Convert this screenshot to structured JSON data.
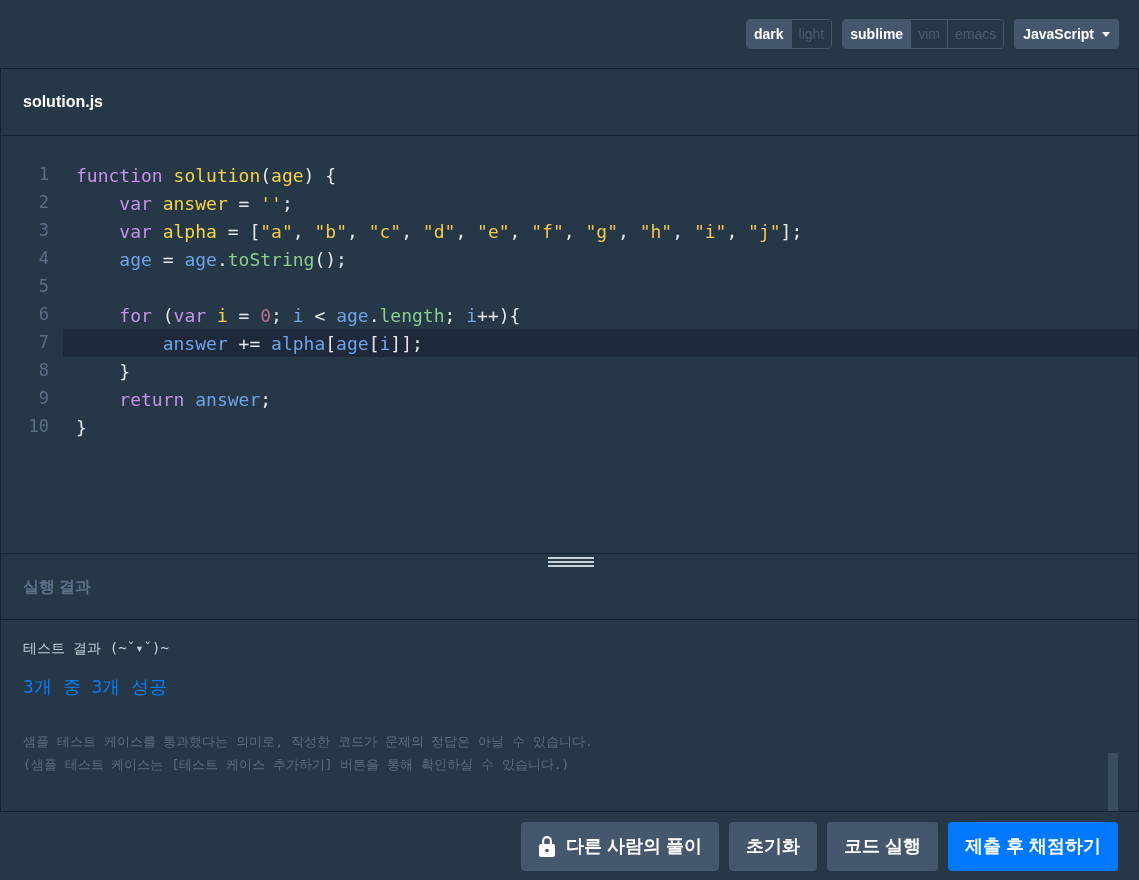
{
  "toolbar": {
    "groups": [
      {
        "options": [
          {
            "label": "dark",
            "selected": true
          },
          {
            "label": "light",
            "selected": false
          }
        ]
      },
      {
        "options": [
          {
            "label": "sublime",
            "selected": true
          },
          {
            "label": "vim",
            "selected": false
          },
          {
            "label": "emacs",
            "selected": false
          }
        ]
      }
    ],
    "language": "JavaScript"
  },
  "editor": {
    "filename": "solution.js",
    "lines": [
      {
        "number": "1",
        "active": false,
        "tokens": [
          {
            "kind": "kw",
            "text": "function"
          },
          {
            "kind": "def",
            "text": " solution"
          },
          {
            "kind": "p",
            "text": "("
          },
          {
            "kind": "def",
            "text": "age"
          },
          {
            "kind": "p",
            "text": ") {"
          }
        ]
      },
      {
        "number": "2",
        "active": false,
        "tokens": [
          {
            "kind": "kw",
            "text": "    var"
          },
          {
            "kind": "def",
            "text": " answer"
          },
          {
            "kind": "p",
            "text": " = "
          },
          {
            "kind": "str",
            "text": "''"
          },
          {
            "kind": "p",
            "text": ";"
          }
        ]
      },
      {
        "number": "3",
        "active": false,
        "tokens": [
          {
            "kind": "kw",
            "text": "    var"
          },
          {
            "kind": "def",
            "text": " alpha"
          },
          {
            "kind": "p",
            "text": " = ["
          },
          {
            "kind": "str",
            "text": "\"a\""
          },
          {
            "kind": "p",
            "text": ", "
          },
          {
            "kind": "str",
            "text": "\"b\""
          },
          {
            "kind": "p",
            "text": ", "
          },
          {
            "kind": "str",
            "text": "\"c\""
          },
          {
            "kind": "p",
            "text": ", "
          },
          {
            "kind": "str",
            "text": "\"d\""
          },
          {
            "kind": "p",
            "text": ", "
          },
          {
            "kind": "str",
            "text": "\"e\""
          },
          {
            "kind": "p",
            "text": ", "
          },
          {
            "kind": "str",
            "text": "\"f\""
          },
          {
            "kind": "p",
            "text": ", "
          },
          {
            "kind": "str",
            "text": "\"g\""
          },
          {
            "kind": "p",
            "text": ", "
          },
          {
            "kind": "str",
            "text": "\"h\""
          },
          {
            "kind": "p",
            "text": ", "
          },
          {
            "kind": "str",
            "text": "\"i\""
          },
          {
            "kind": "p",
            "text": ", "
          },
          {
            "kind": "str",
            "text": "\"j\""
          },
          {
            "kind": "p",
            "text": "];"
          }
        ]
      },
      {
        "number": "4",
        "active": false,
        "tokens": [
          {
            "kind": "var",
            "text": "    age"
          },
          {
            "kind": "p",
            "text": " = "
          },
          {
            "kind": "var",
            "text": "age"
          },
          {
            "kind": "p",
            "text": "."
          },
          {
            "kind": "prop",
            "text": "toString"
          },
          {
            "kind": "p",
            "text": "();"
          }
        ]
      },
      {
        "number": "5",
        "active": false
      },
      {
        "number": "6",
        "active": false,
        "tokens": [
          {
            "kind": "kw",
            "text": "    for"
          },
          {
            "kind": "p",
            "text": " ("
          },
          {
            "kind": "kw",
            "text": "var"
          },
          {
            "kind": "def",
            "text": " i"
          },
          {
            "kind": "p",
            "text": " = "
          },
          {
            "kind": "num",
            "text": "0"
          },
          {
            "kind": "p",
            "text": "; "
          },
          {
            "kind": "var",
            "text": "i"
          },
          {
            "kind": "p",
            "text": " < "
          },
          {
            "kind": "var",
            "text": "age"
          },
          {
            "kind": "p",
            "text": "."
          },
          {
            "kind": "prop",
            "text": "length"
          },
          {
            "kind": "p",
            "text": "; "
          },
          {
            "kind": "var",
            "text": "i"
          },
          {
            "kind": "p",
            "text": "++){"
          }
        ]
      },
      {
        "number": "7",
        "active": true,
        "tokens": [
          {
            "kind": "var",
            "text": "        answer"
          },
          {
            "kind": "p",
            "text": " += "
          },
          {
            "kind": "var",
            "text": "alpha"
          },
          {
            "kind": "p",
            "text": "["
          },
          {
            "kind": "var",
            "text": "age"
          },
          {
            "kind": "p",
            "text": "["
          },
          {
            "kind": "var",
            "text": "i"
          },
          {
            "kind": "p",
            "text": "]];"
          }
        ]
      },
      {
        "number": "8",
        "active": false,
        "tokens": [
          {
            "kind": "p",
            "text": "    }"
          }
        ]
      },
      {
        "number": "9",
        "active": false,
        "tokens": [
          {
            "kind": "kw",
            "text": "    return"
          },
          {
            "kind": "var",
            "text": " answer"
          },
          {
            "kind": "p",
            "text": ";"
          }
        ]
      },
      {
        "number": "10",
        "active": false,
        "tokens": [
          {
            "kind": "p",
            "text": "}"
          }
        ]
      }
    ]
  },
  "results": {
    "title": "실행 결과",
    "heading": "테스트 결과 (~ˇ▾ˇ)~",
    "summary": "3개 중 3개 성공",
    "notes": [
      "샘플 테스트 케이스를 통과했다는 의미로, 작성한 코드가 문제의 정답은 아닐 수 있습니다.",
      "(샘플 테스트 케이스는 [테스트 케이스 추가하기] 버튼을 통해 확인하실 수 있습니다.)"
    ]
  },
  "actions": [
    {
      "label": "다른 사람의 풀이",
      "kind": "locked"
    },
    {
      "label": "초기화",
      "kind": "secondary"
    },
    {
      "label": "코드 실행",
      "kind": "secondary"
    },
    {
      "label": "제출 후 채점하기",
      "kind": "primary"
    }
  ]
}
